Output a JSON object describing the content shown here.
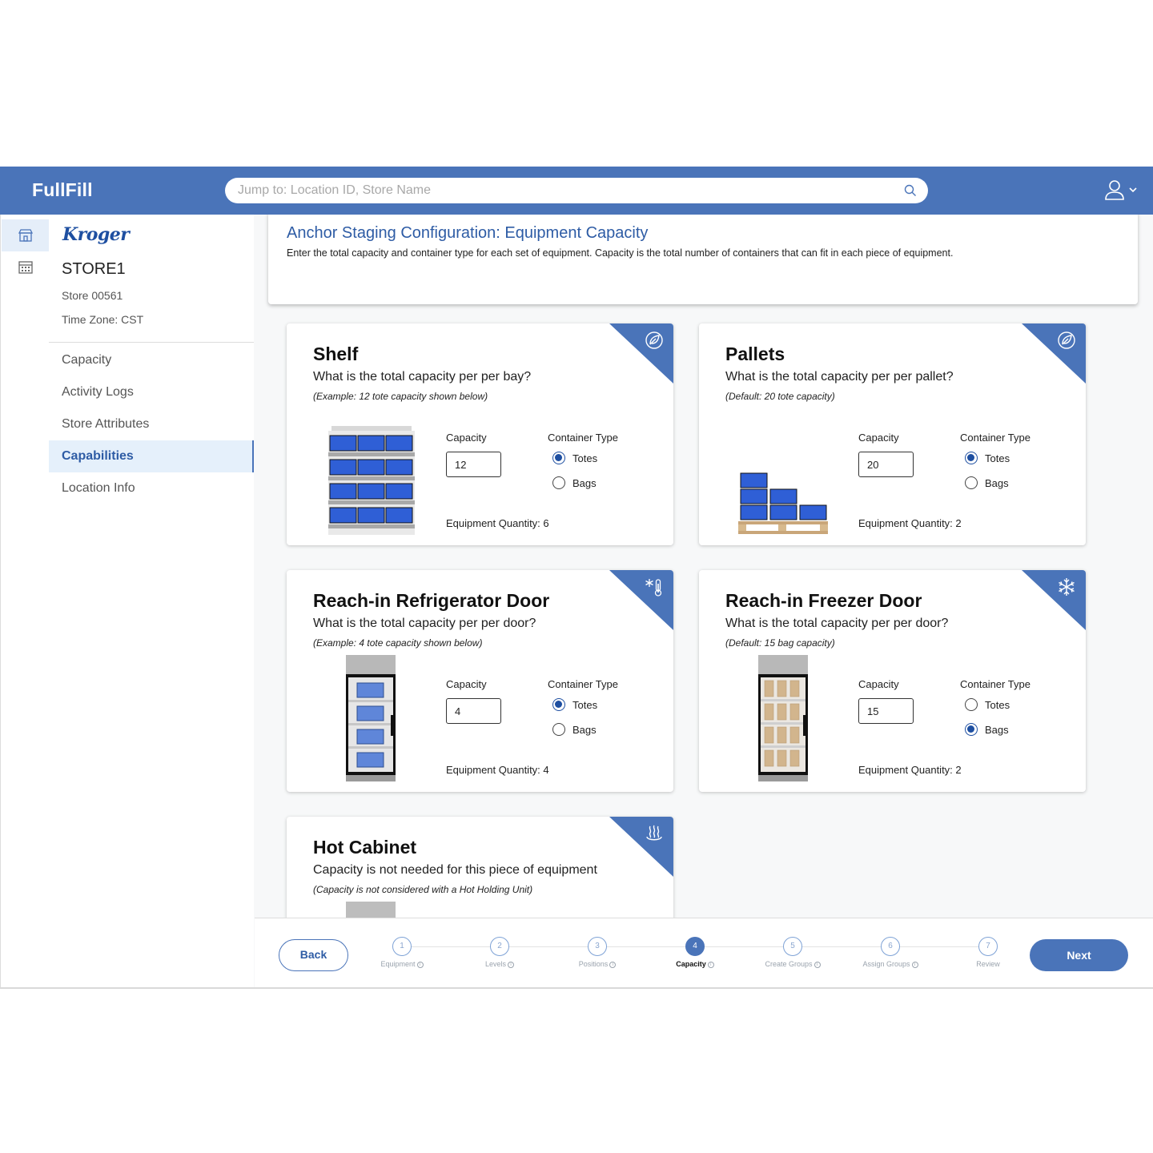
{
  "app": {
    "brand": "FullFill"
  },
  "search": {
    "placeholder": "Jump to: Location ID, Store Name"
  },
  "store": {
    "logo_text": "Kroger",
    "name": "STORE1",
    "number": "Store 00561",
    "timezone": "Time Zone: CST"
  },
  "nav": {
    "items": [
      {
        "label": "Capacity"
      },
      {
        "label": "Activity Logs"
      },
      {
        "label": "Store Attributes"
      },
      {
        "label": "Capabilities",
        "active": true
      },
      {
        "label": "Location Info"
      }
    ]
  },
  "page": {
    "title": "Anchor Staging Configuration: Equipment Capacity",
    "description": "Enter the total capacity and container type for each set of equipment. Capacity is the total number of containers that can fit in each piece of equipment."
  },
  "labels": {
    "capacity": "Capacity",
    "container_type": "Container Type",
    "totes": "Totes",
    "bags": "Bags"
  },
  "cards": [
    {
      "title": "Shelf",
      "question": "What is the total capacity per per bay?",
      "example": "(Example: 12 tote capacity shown below)",
      "capacity": "12",
      "container": "Totes",
      "quantity": "Equipment Quantity: 6",
      "icon": "leaf-icon"
    },
    {
      "title": "Pallets",
      "question": "What is the total capacity per per pallet?",
      "example": "(Default: 20 tote capacity)",
      "capacity": "20",
      "container": "Totes",
      "quantity": "Equipment Quantity: 2",
      "icon": "leaf-icon"
    },
    {
      "title": "Reach-in Refrigerator Door",
      "question": "What is the total capacity per per door?",
      "example": "(Example: 4 tote capacity shown below)",
      "capacity": "4",
      "container": "Totes",
      "quantity": "Equipment Quantity: 4",
      "icon": "snow-thermometer-icon"
    },
    {
      "title": "Reach-in Freezer Door",
      "question": "What is the total capacity per per door?",
      "example": "(Default: 15 bag capacity)",
      "capacity": "15",
      "container": "Bags",
      "quantity": "Equipment Quantity: 2",
      "icon": "snowflake-icon"
    },
    {
      "title": "Hot Cabinet",
      "question": "Capacity is not needed for this piece of equipment",
      "example": "(Capacity is not considered with a Hot Holding Unit)",
      "icon": "heat-icon"
    }
  ],
  "footer": {
    "back": "Back",
    "next": "Next",
    "steps": [
      {
        "num": "1",
        "label": "Equipment",
        "info": "i"
      },
      {
        "num": "2",
        "label": "Levels",
        "info": "i"
      },
      {
        "num": "3",
        "label": "Positions",
        "info": "i"
      },
      {
        "num": "4",
        "label": "Capacity",
        "info": "i",
        "active": true
      },
      {
        "num": "5",
        "label": "Create Groups",
        "info": "i"
      },
      {
        "num": "6",
        "label": "Assign Groups",
        "info": "i"
      },
      {
        "num": "7",
        "label": "Review"
      }
    ]
  },
  "colors": {
    "primary": "#4a74b9",
    "tote": "#2f5fd6",
    "radio": "#1e4fa1"
  }
}
